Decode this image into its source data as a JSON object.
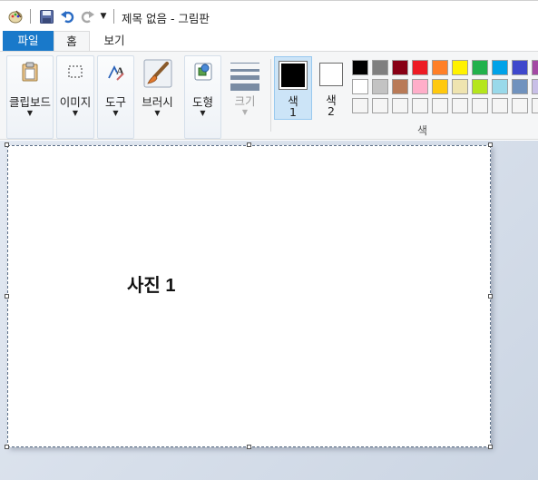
{
  "window": {
    "title": "제목 없음 - 그림판"
  },
  "tabs": {
    "file": "파일",
    "home": "홈",
    "view": "보기"
  },
  "ribbon": {
    "groups": {
      "clipboard": "클립보드",
      "image": "이미지",
      "tools": "도구",
      "brushes": "브러시",
      "shapes": "도형",
      "size": "크기"
    },
    "color1": {
      "label": "색",
      "num": "1",
      "value": "#000000"
    },
    "color2": {
      "label": "색",
      "num": "2",
      "value": "#ffffff"
    },
    "colors_label": "색",
    "palette": [
      [
        "#000000",
        "#7f7f7f",
        "#880015",
        "#ed1c24",
        "#ff7f27",
        "#fff200",
        "#22b14c",
        "#00a2e8",
        "#3f48cc",
        "#a349a4"
      ],
      [
        "#ffffff",
        "#c3c3c3",
        "#b97a57",
        "#ffaec9",
        "#ffc90e",
        "#efe4b0",
        "#b5e61d",
        "#99d9ea",
        "#7092be",
        "#c8bfe7"
      ],
      [
        "#f5f5f5",
        "#f5f5f5",
        "#f5f5f5",
        "#f5f5f5",
        "#f5f5f5",
        "#f5f5f5",
        "#f5f5f5",
        "#f5f5f5",
        "#f5f5f5",
        "#f5f5f5"
      ]
    ]
  },
  "canvas": {
    "text": "사진 1"
  }
}
